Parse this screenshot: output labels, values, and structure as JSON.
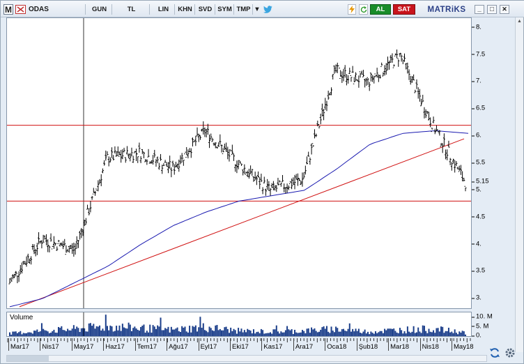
{
  "toolbar": {
    "icon_m": "M",
    "symbol": "ODAS",
    "period": "GUN",
    "currency": "TL",
    "scale_lin": "LIN",
    "khn": "KHN",
    "svd": "SVD",
    "sym": "SYM",
    "tmp": "TMP",
    "dropdown_arrow": "▼",
    "twitter_icon": "twitter-icon",
    "lightning_icon": "lightning-icon",
    "refresh_icon": "refresh-icon",
    "buy_label": "AL",
    "sell_label": "SAT",
    "brand": "MATRiKS",
    "minimize": "_",
    "maximize": "□",
    "close": "✕"
  },
  "price_axis": {
    "ticks": [
      {
        "label": "8.",
        "value": 8.0
      },
      {
        "label": "7.5",
        "value": 7.5
      },
      {
        "label": "7.",
        "value": 7.0
      },
      {
        "label": "6.5",
        "value": 6.5
      },
      {
        "label": "6.",
        "value": 6.0
      },
      {
        "label": "5.5",
        "value": 5.5
      },
      {
        "label": "5.15",
        "value": 5.15
      },
      {
        "label": "5.",
        "value": 5.0
      },
      {
        "label": "4.5",
        "value": 4.5
      },
      {
        "label": "4.",
        "value": 4.0
      },
      {
        "label": "3.5",
        "value": 3.5
      },
      {
        "label": "3.",
        "value": 3.0
      }
    ]
  },
  "volume_panel": {
    "label": "Volume",
    "ticks": [
      {
        "label": "10. M",
        "value": 10
      },
      {
        "label": "5. M",
        "value": 5
      },
      {
        "label": "0.",
        "value": 0
      }
    ]
  },
  "date_axis": {
    "labels": [
      "Mar17",
      "Nis17",
      "May17",
      "Haz17",
      "Tem17",
      "Ağu17",
      "Eyl17",
      "Eki17",
      "Kas17",
      "Ara17",
      "Oca18",
      "Şub18",
      "Mar18",
      "Nis18",
      "May18"
    ]
  },
  "chart_data": {
    "type": "line",
    "title": "",
    "xlabel": "",
    "ylabel": "",
    "x": [
      "Mar17",
      "Nis17",
      "May17",
      "Haz17",
      "Tem17",
      "Ağu17",
      "Eyl17",
      "Eki17",
      "Kas17",
      "Ara17",
      "Oca18",
      "Şub18",
      "Mar18",
      "Nis18",
      "May18"
    ],
    "ylim": [
      2.9,
      8.1
    ],
    "series": [
      {
        "role": "price-bars",
        "color": "#000000",
        "values": [
          3.3,
          4.1,
          3.9,
          5.6,
          5.7,
          5.4,
          6.1,
          5.5,
          5.0,
          5.2,
          7.2,
          7.0,
          7.5,
          6.2,
          5.15
        ]
      },
      {
        "role": "moving-average",
        "color": "#1a1ab0",
        "values": [
          2.85,
          3.0,
          3.3,
          3.6,
          4.0,
          4.35,
          4.6,
          4.8,
          4.9,
          5.0,
          5.4,
          5.85,
          6.05,
          6.1,
          6.05
        ]
      },
      {
        "role": "volume",
        "color": "#1b3e8a",
        "values": [
          1.5,
          3.0,
          4.0,
          5.5,
          4.5,
          3.5,
          5.0,
          3.0,
          2.5,
          3.0,
          4.0,
          2.5,
          3.5,
          4.0,
          2.0
        ]
      }
    ],
    "horizontal_lines": [
      6.2,
      4.8
    ],
    "trendline": {
      "color": "#d01010",
      "from": {
        "x": "Mar17",
        "y": 2.85
      },
      "to": {
        "x": "May18",
        "y": 5.95
      }
    },
    "grid": false,
    "legend": "none"
  },
  "colors": {
    "panel_bg": "#ffffff",
    "buy": "#198c2a",
    "sell": "#c8141c",
    "brand": "#2b3f86",
    "hline": "#d01010",
    "ma": "#1a1ab0",
    "volume": "#1b3e8a"
  },
  "icons": {
    "sync": "sync-icon",
    "settings": "settings-icon"
  }
}
